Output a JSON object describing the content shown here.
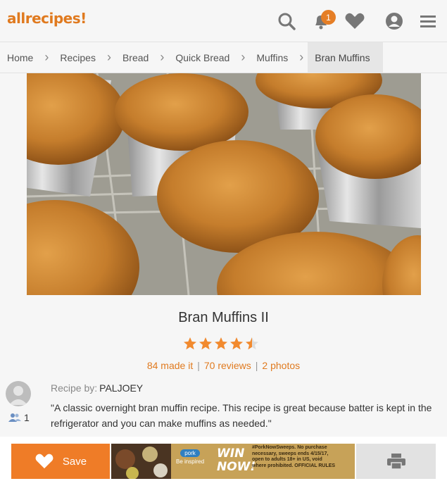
{
  "header": {
    "logo_text": "allrecipes",
    "notification_count": "1",
    "icons": [
      "search-icon",
      "bell-icon",
      "heart-icon",
      "profile-icon",
      "menu-icon"
    ]
  },
  "breadcrumb": {
    "items": [
      "Home",
      "Recipes",
      "Bread",
      "Quick Bread",
      "Muffins",
      "Bran Muffins"
    ]
  },
  "recipe": {
    "title": "Bran Muffins II",
    "rating": 4.5,
    "made_it": "84 made it",
    "reviews": "70 reviews",
    "photos": "2 photos",
    "byline_label": "Recipe by:",
    "author": "PALJOEY",
    "followers": "1",
    "description": "\"A classic overnight bran muffin recipe. This recipe is great because batter is kept in the refrigerator and you can make muffins as needed.\""
  },
  "bottombar": {
    "save_label": "Save",
    "ad": {
      "brand_pill": "pork",
      "brand_tag": "Be inspired",
      "headline_1": "WIN",
      "headline_2": "NOW!",
      "fine_print": "#PorkNowSweeps. No purchase necessary, sweeps ends 4/15/17, open to adults 18+ in US, void where prohibited. OFFICIAL RULES"
    }
  },
  "colors": {
    "accent": "#ef7c27",
    "logo": "#e07a1f",
    "star": "#f28a2e"
  }
}
